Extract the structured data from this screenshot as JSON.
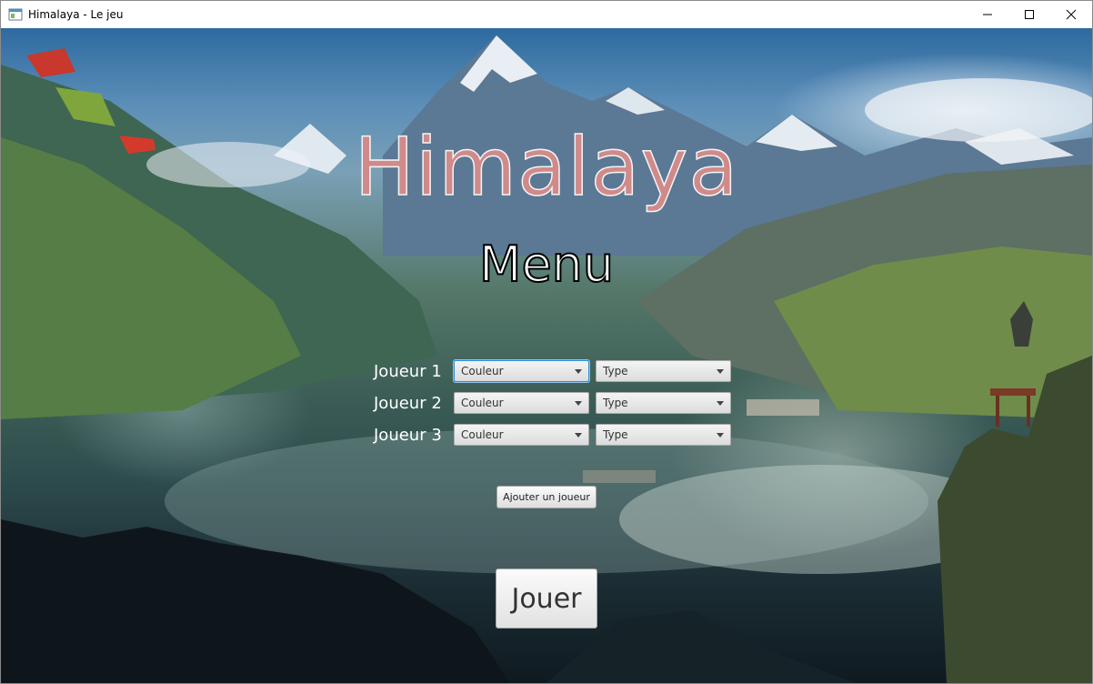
{
  "window": {
    "title": "Himalaya - Le jeu"
  },
  "game": {
    "title": "Himalaya",
    "subtitle": "Menu"
  },
  "players": [
    {
      "label": "Joueur 1",
      "color_value": "Couleur",
      "type_value": "Type"
    },
    {
      "label": "Joueur 2",
      "color_value": "Couleur",
      "type_value": "Type"
    },
    {
      "label": "Joueur 3",
      "color_value": "Couleur",
      "type_value": "Type"
    }
  ],
  "buttons": {
    "add_player": "Ajouter un joueur",
    "play": "Jouer"
  },
  "colors": {
    "title_text": "#d08a8a",
    "focus_border": "#2a8cd8"
  }
}
